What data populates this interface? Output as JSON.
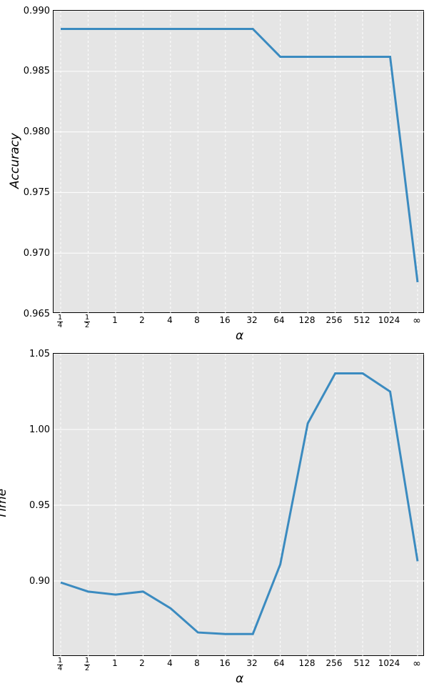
{
  "chart_data": [
    {
      "type": "line",
      "title": "",
      "xlabel": "α",
      "ylabel": "Accuracy",
      "ylim": [
        0.965,
        0.99
      ],
      "yticks": [
        0.965,
        0.97,
        0.975,
        0.98,
        0.985,
        0.99
      ],
      "categories": [
        "1/4",
        "1/2",
        "1",
        "2",
        "4",
        "8",
        "16",
        "32",
        "64",
        "128",
        "256",
        "512",
        "1024",
        "∞"
      ],
      "values": [
        0.9885,
        0.9885,
        0.9885,
        0.9885,
        0.9885,
        0.9885,
        0.9885,
        0.9885,
        0.9862,
        0.9862,
        0.9862,
        0.9862,
        0.9862,
        0.9676
      ]
    },
    {
      "type": "line",
      "title": "",
      "xlabel": "α",
      "ylabel": "Time",
      "ylim": [
        0.85,
        1.05
      ],
      "yticks": [
        0.85,
        0.9,
        0.95,
        1.0,
        1.05
      ],
      "categories": [
        "1/4",
        "1/2",
        "1",
        "2",
        "4",
        "8",
        "16",
        "32",
        "64",
        "128",
        "256",
        "512",
        "1024",
        "∞"
      ],
      "values": [
        0.899,
        0.893,
        0.891,
        0.893,
        0.882,
        0.866,
        0.865,
        0.865,
        0.911,
        1.004,
        1.037,
        1.037,
        1.025,
        0.913
      ]
    }
  ],
  "panels": {
    "top": {
      "ylabel": "Accuracy",
      "xlabel": "α"
    },
    "bottom": {
      "ylabel": "Time",
      "xlabel": "α"
    }
  }
}
